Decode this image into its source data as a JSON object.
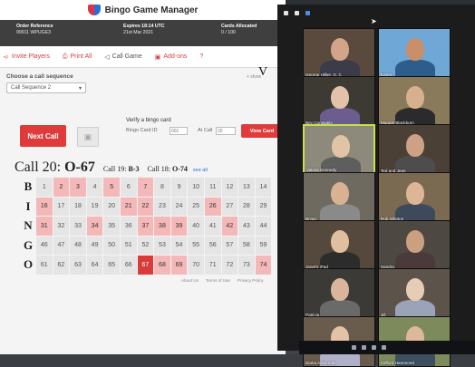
{
  "app": {
    "title": "Bingo Game Manager",
    "order_ref_label": "Order Reference",
    "order_ref_value": "99911 WPUGE3",
    "expires_label": "Expires 18:14 UTC",
    "expires_value": "21st Mar 2021",
    "cards_label": "Cards Allocated",
    "cards_value": "0 / 100"
  },
  "nav": {
    "invite": "Invite Players",
    "print": "Print All",
    "call_game": "Call Game",
    "addons": "Add-ons",
    "help": "?"
  },
  "sequence": {
    "label": "Choose a call sequence",
    "selected": "Call Sequence 2",
    "show_link": "+ show"
  },
  "controls": {
    "next_call": "Next Call",
    "stop_icon": "stop-icon",
    "verify_title": "Verify a bingo card",
    "card_id_label": "Bingo Card ID",
    "card_id_value": "001",
    "at_call_label": "At Call",
    "at_call_value": "20",
    "view_card": "View Card"
  },
  "calls": {
    "current_label": "Call 20:",
    "current_value": "O-67",
    "prev1_label": "Call 19:",
    "prev1_value": "B-3",
    "prev2_label": "Call 18:",
    "prev2_value": "O-74",
    "see_all": "see all"
  },
  "board": [
    {
      "letter": "B",
      "numbers": [
        "1",
        "2",
        "3",
        "4",
        "5",
        "6",
        "7",
        "8",
        "9",
        "10",
        "11",
        "12",
        "13",
        "14"
      ],
      "called": [
        "2",
        "3",
        "5",
        "7"
      ],
      "current": ""
    },
    {
      "letter": "I",
      "numbers": [
        "16",
        "17",
        "18",
        "19",
        "20",
        "21",
        "22",
        "23",
        "24",
        "25",
        "26",
        "27",
        "28",
        "29"
      ],
      "called": [
        "16",
        "21",
        "22",
        "26"
      ],
      "current": ""
    },
    {
      "letter": "N",
      "numbers": [
        "31",
        "32",
        "33",
        "34",
        "35",
        "36",
        "37",
        "38",
        "39",
        "40",
        "41",
        "42",
        "43",
        "44"
      ],
      "called": [
        "31",
        "34",
        "37",
        "38",
        "39",
        "42"
      ],
      "current": ""
    },
    {
      "letter": "G",
      "numbers": [
        "46",
        "47",
        "48",
        "49",
        "50",
        "51",
        "52",
        "53",
        "54",
        "55",
        "56",
        "57",
        "58",
        "59"
      ],
      "called": [],
      "current": ""
    },
    {
      "letter": "O",
      "numbers": [
        "61",
        "62",
        "63",
        "64",
        "65",
        "66",
        "67",
        "68",
        "69",
        "70",
        "71",
        "72",
        "73",
        "74"
      ],
      "called": [
        "68",
        "69",
        "74"
      ],
      "current": "67"
    }
  ],
  "footer": {
    "about": "About Us",
    "terms": "Terms of Use",
    "privacy": "Privacy Policy"
  },
  "partial_text": "V",
  "zoom": {
    "participants": [
      {
        "name": "George Hillier, G, C",
        "bg": "#5a4a3e",
        "skin": "#d2a58a",
        "shirt": "#3b3b4a"
      },
      {
        "name": "Karen",
        "bg": "#6fa8d6",
        "skin": "#c98f6a",
        "shirt": "#2d5d8a"
      },
      {
        "name": "Bev Constable",
        "bg": "#3d3a34",
        "skin": "#e2c2aa",
        "shirt": "#6b5e8e"
      },
      {
        "name": "Maggie Blackburn",
        "bg": "#8a7a5c",
        "skin": "#d8b08e",
        "shirt": "#2b2b2b"
      },
      {
        "name": "Valerie Kennedy",
        "bg": "#8d8a7c",
        "skin": "#e1c3a6",
        "shirt": "#5e5e5e"
      },
      {
        "name": "Ted and Jean",
        "bg": "#4a4036",
        "skin": "#cfa184",
        "shirt": "#4d4d4d"
      },
      {
        "name": "Bryan",
        "bg": "#6e6a60",
        "skin": "#d9b294",
        "shirt": "#8a8a8a"
      },
      {
        "name": "Rob Shipton",
        "bg": "#7b6a52",
        "skin": "#dcb696",
        "shirt": "#3e4a5c"
      },
      {
        "name": "Janet's iPad",
        "bg": "#55483c",
        "skin": "#e0bea0",
        "shirt": "#2c2c2c"
      },
      {
        "name": "Sandra",
        "bg": "#4d4942",
        "skin": "#caa080",
        "shirt": "#4a3a3a"
      },
      {
        "name": "Patricia",
        "bg": "#3b3a36",
        "skin": "#d9b59b",
        "shirt": "#6a6a6a"
      },
      {
        "name": "Jill",
        "bg": "#5c544a",
        "skin": "#e6cdb6",
        "shirt": "#9aa3b8"
      },
      {
        "name": "Diana Ackerman",
        "bg": "#6a5c4c",
        "skin": "#e4c2a6",
        "shirt": "#b0b0c8"
      },
      {
        "name": "Clifford Hammond",
        "bg": "#7c8a5c",
        "skin": "#dcb89c",
        "shirt": "#3c5060"
      }
    ]
  }
}
